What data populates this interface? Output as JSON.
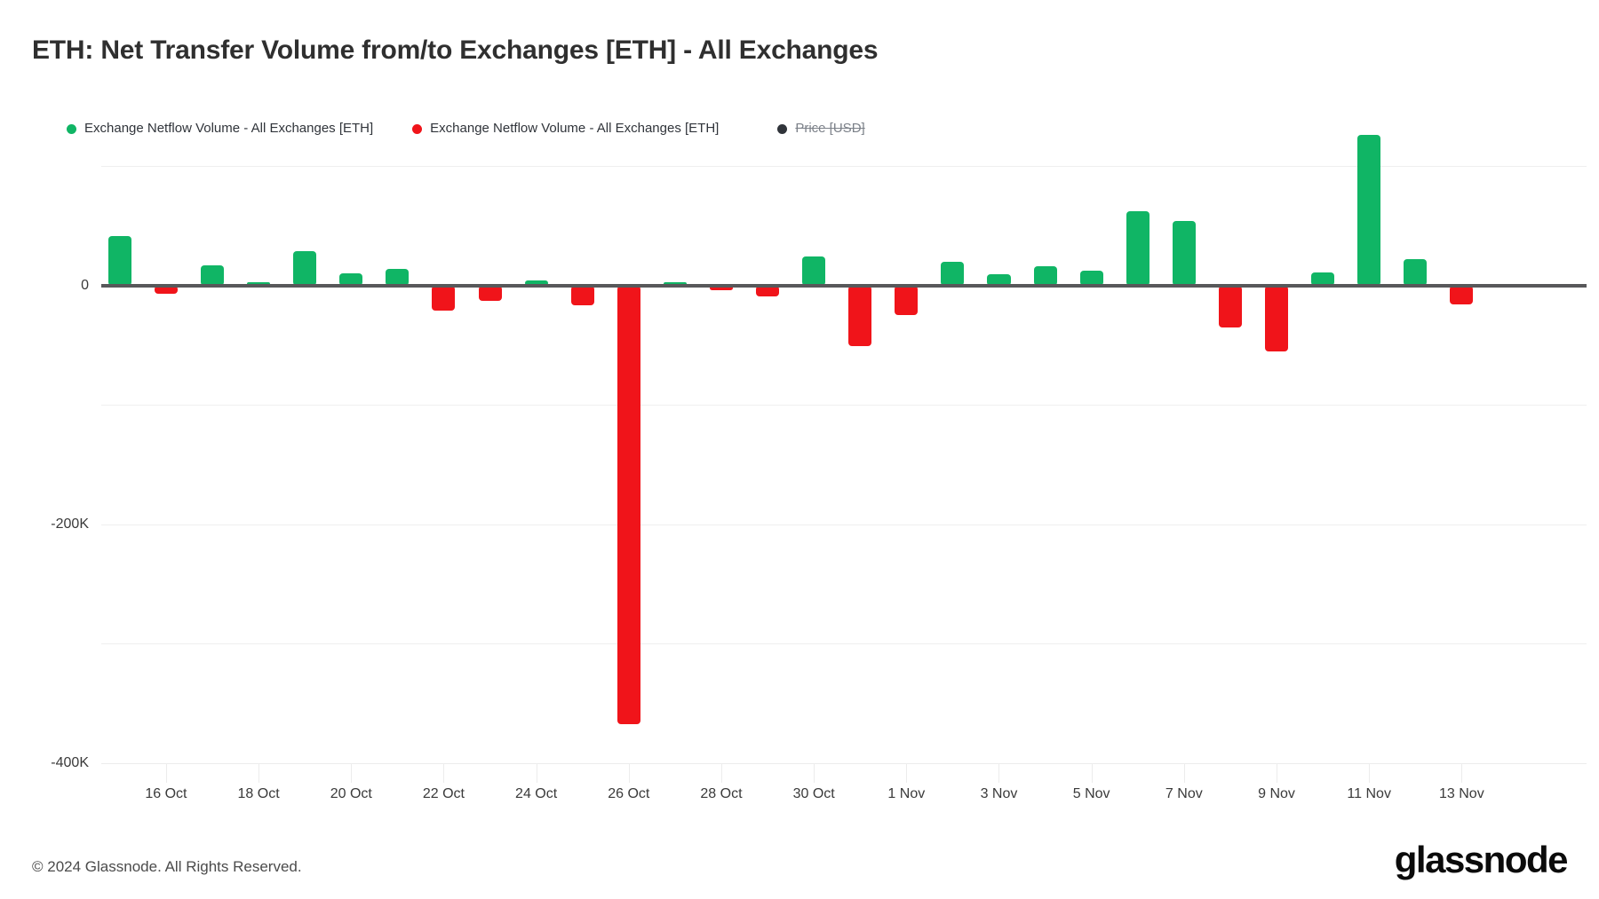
{
  "header": {
    "title": "ETH: Net Transfer Volume from/to Exchanges [ETH] - All Exchanges"
  },
  "legend": {
    "items": [
      {
        "label": "Exchange Netflow Volume - All Exchanges [ETH]",
        "color": "#10b565",
        "marker": "circle-dot-icon",
        "enabled": true
      },
      {
        "label": "Exchange Netflow Volume - All Exchanges [ETH]",
        "color": "#f0141a",
        "marker": "circle-dot-icon",
        "enabled": true
      },
      {
        "label": "Price [USD]",
        "color": "#30343a",
        "marker": "circle-dot-icon",
        "enabled": false
      }
    ]
  },
  "footer": {
    "copyright": "© 2024 Glassnode. All Rights Reserved.",
    "brand": "glassnode"
  },
  "chart_data": {
    "type": "bar",
    "title": "ETH: Net Transfer Volume from/to Exchanges [ETH] - All Exchanges",
    "xlabel": "",
    "ylabel": "",
    "ylim": [
      -400000,
      120000
    ],
    "grid": true,
    "legend_position": "top-left",
    "y_ticks": [
      {
        "label": "0",
        "value": 0
      },
      {
        "label": "-200K",
        "value": -200000
      },
      {
        "label": "-400K",
        "value": -400000
      }
    ],
    "y_gridlines": [
      100000,
      0,
      -100000,
      -200000,
      -300000,
      -400000
    ],
    "x_ticks": [
      "16 Oct",
      "18 Oct",
      "20 Oct",
      "22 Oct",
      "24 Oct",
      "26 Oct",
      "28 Oct",
      "30 Oct",
      "1 Nov",
      "3 Nov",
      "5 Nov",
      "7 Nov",
      "9 Nov",
      "11 Nov",
      "13 Nov"
    ],
    "colors": {
      "positive": "#10b565",
      "negative": "#f0141a",
      "zero_axis": "#58585a",
      "grid": "#efefef"
    },
    "categories": [
      "15 Oct",
      "16 Oct",
      "17 Oct",
      "18 Oct",
      "19 Oct",
      "20 Oct",
      "21 Oct",
      "22 Oct",
      "23 Oct",
      "24 Oct",
      "25 Oct",
      "26 Oct",
      "27 Oct",
      "28 Oct",
      "29 Oct",
      "30 Oct",
      "31 Oct",
      "1 Nov",
      "2 Nov",
      "3 Nov",
      "4 Nov",
      "5 Nov",
      "6 Nov",
      "7 Nov",
      "8 Nov",
      "9 Nov",
      "10 Nov",
      "11 Nov",
      "12 Nov",
      "13 Nov"
    ],
    "series": [
      {
        "name": "Exchange Netflow Volume - All Exchanges [ETH]",
        "values": [
          41000,
          -7000,
          17000,
          1000,
          29000,
          10000,
          14000,
          -21000,
          -13000,
          4000,
          -17000,
          -367000,
          0,
          -4000,
          -9000,
          24000,
          -51000,
          -25000,
          20000,
          9000,
          16000,
          12000,
          62000,
          54000,
          -35000,
          -55000,
          11000,
          126000,
          22000,
          -16000
        ]
      }
    ]
  }
}
